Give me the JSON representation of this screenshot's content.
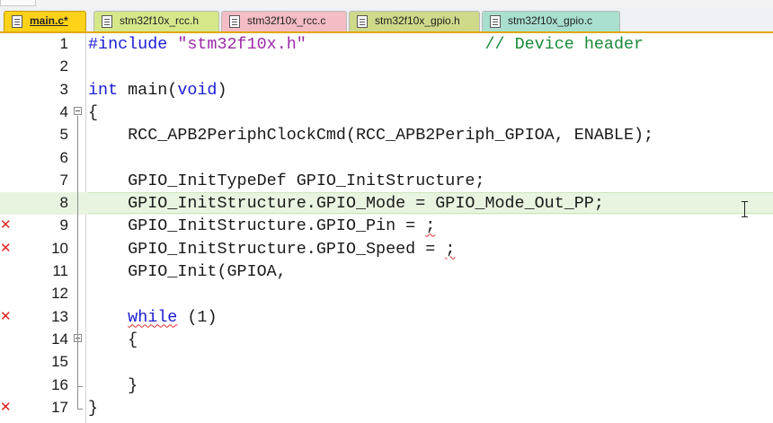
{
  "tabs": [
    {
      "label": "main.c*",
      "style": "active"
    },
    {
      "label": "stm32f10x_rcc.h",
      "style": "rcch"
    },
    {
      "label": "stm32f10x_rcc.c",
      "style": "rccc"
    },
    {
      "label": "stm32f10x_gpio.h",
      "style": "gpioh"
    },
    {
      "label": "stm32f10x_gpio.c",
      "style": "gpioc"
    }
  ],
  "editor": {
    "current_line": 8,
    "lines": [
      {
        "num": "1",
        "error": false,
        "fold": "",
        "tokens": [
          [
            "pp",
            "#include "
          ],
          [
            "str",
            "\"stm32f10x.h\""
          ],
          [
            "",
            "                  "
          ],
          [
            "cmt",
            "// Device header"
          ]
        ]
      },
      {
        "num": "2",
        "error": false,
        "fold": "",
        "tokens": []
      },
      {
        "num": "3",
        "error": false,
        "fold": "",
        "tokens": [
          [
            "kw",
            "int"
          ],
          [
            "",
            " main("
          ],
          [
            "kw",
            "void"
          ],
          [
            "",
            ")"
          ]
        ]
      },
      {
        "num": "4",
        "error": false,
        "fold": "open",
        "tokens": [
          [
            "",
            "{"
          ]
        ]
      },
      {
        "num": "5",
        "error": false,
        "fold": "",
        "tokens": [
          [
            "",
            "    RCC_APB2PeriphClockCmd(RCC_APB2Periph_GPIOA, ENABLE);"
          ]
        ]
      },
      {
        "num": "6",
        "error": false,
        "fold": "",
        "tokens": []
      },
      {
        "num": "7",
        "error": false,
        "fold": "",
        "tokens": [
          [
            "",
            "    GPIO_InitTypeDef GPIO_InitStructure;"
          ]
        ]
      },
      {
        "num": "8",
        "error": false,
        "fold": "",
        "tokens": [
          [
            "",
            "    GPIO_InitStructure.GPIO_Mode = GPIO_Mode_Out_PP;"
          ]
        ]
      },
      {
        "num": "9",
        "error": true,
        "fold": "",
        "tokens": [
          [
            "",
            "    GPIO_InitStructure.GPIO_Pin = "
          ],
          [
            "squig",
            ";"
          ]
        ]
      },
      {
        "num": "10",
        "error": true,
        "fold": "",
        "tokens": [
          [
            "",
            "    GPIO_InitStructure.GPIO_Speed = "
          ],
          [
            "squig",
            ";"
          ]
        ]
      },
      {
        "num": "11",
        "error": false,
        "fold": "",
        "tokens": [
          [
            "",
            "    GPIO_Init(GPIOA,"
          ]
        ]
      },
      {
        "num": "12",
        "error": false,
        "fold": "",
        "tokens": []
      },
      {
        "num": "13",
        "error": true,
        "fold": "",
        "tokens": [
          [
            "",
            "    "
          ],
          [
            "kw squig",
            "while"
          ],
          [
            "",
            " (1)"
          ]
        ]
      },
      {
        "num": "14",
        "error": false,
        "fold": "open",
        "tokens": [
          [
            "",
            "    {"
          ]
        ]
      },
      {
        "num": "15",
        "error": false,
        "fold": "",
        "tokens": []
      },
      {
        "num": "16",
        "error": false,
        "fold": "",
        "tokens": [
          [
            "",
            "    }"
          ]
        ]
      },
      {
        "num": "17",
        "error": true,
        "fold": "",
        "tokens": [
          [
            "",
            "}"
          ]
        ]
      }
    ]
  },
  "icons": {
    "file": "file-icon",
    "error": "error-cross-icon",
    "fold": "fold-collapse-icon",
    "cursor": "text-cursor-icon"
  }
}
